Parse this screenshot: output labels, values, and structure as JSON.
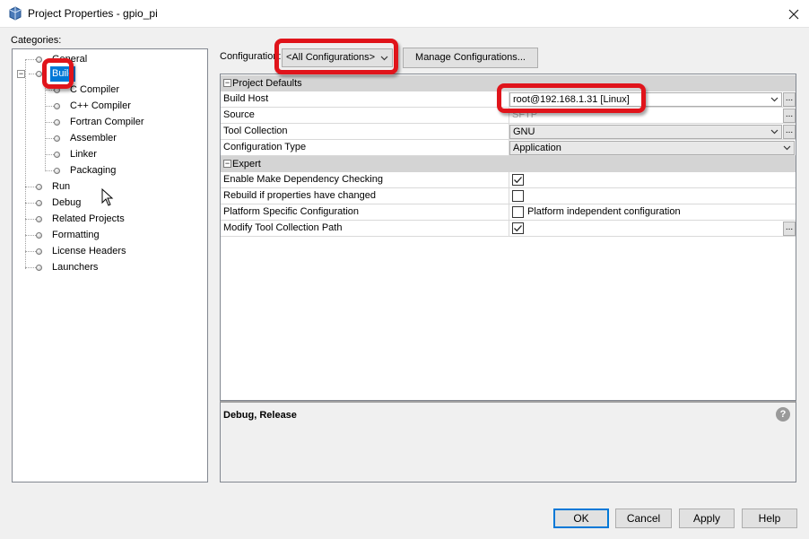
{
  "window": {
    "title": "Project Properties - gpio_pi"
  },
  "categories": {
    "label": "Categories:",
    "items": [
      {
        "label": "General"
      },
      {
        "label": "Build",
        "selected": true
      },
      {
        "label": "C Compiler"
      },
      {
        "label": "C++ Compiler"
      },
      {
        "label": "Fortran Compiler"
      },
      {
        "label": "Assembler"
      },
      {
        "label": "Linker"
      },
      {
        "label": "Packaging"
      },
      {
        "label": "Run"
      },
      {
        "label": "Debug"
      },
      {
        "label": "Related Projects"
      },
      {
        "label": "Formatting"
      },
      {
        "label": "License Headers"
      },
      {
        "label": "Launchers"
      }
    ]
  },
  "configuration": {
    "label": "Configuration:",
    "selected": "<All Configurations>",
    "manage_label": "Manage Configurations..."
  },
  "properties": {
    "project_defaults": {
      "header": "Project Defaults",
      "build_host": {
        "name": "Build Host",
        "value": "root@192.168.1.31 [Linux]"
      },
      "source": {
        "name": "Source",
        "value": "SFTP"
      },
      "tool_collection": {
        "name": "Tool Collection",
        "value": "GNU"
      },
      "configuration_type": {
        "name": "Configuration Type",
        "value": "Application"
      }
    },
    "expert": {
      "header": "Expert",
      "dependency_checking": {
        "name": "Enable Make Dependency Checking",
        "checked": true
      },
      "rebuild": {
        "name": "Rebuild if properties have changed",
        "checked": false
      },
      "platform_specific": {
        "name": "Platform Specific Configuration",
        "checked": false,
        "value": "Platform independent configuration"
      },
      "tool_path": {
        "name": "Modify Tool Collection Path",
        "checked": true
      }
    }
  },
  "description": {
    "text": "Debug, Release",
    "help": "?"
  },
  "buttons": {
    "ok": "OK",
    "cancel": "Cancel",
    "apply": "Apply",
    "help": "Help"
  },
  "ellipsis": "...",
  "colors": {
    "selection": "#0078d7",
    "callout": "#e0141b",
    "category_header": "#d4d4d4"
  }
}
